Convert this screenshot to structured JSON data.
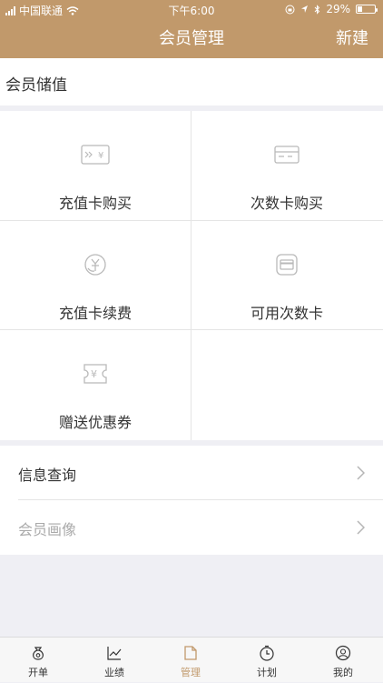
{
  "status_bar": {
    "carrier": "中国联通",
    "time": "下午6:00",
    "battery_percent": "29%",
    "battery_level": 0.29
  },
  "nav": {
    "title": "会员管理",
    "right_action": "新建"
  },
  "section": {
    "title": "会员储值"
  },
  "grid": {
    "items": [
      {
        "label": "充值卡购买",
        "icon": "recharge-card-icon"
      },
      {
        "label": "次数卡购买",
        "icon": "count-card-icon"
      },
      {
        "label": "充值卡续费",
        "icon": "renew-icon"
      },
      {
        "label": "可用次数卡",
        "icon": "available-card-icon"
      },
      {
        "label": "赠送优惠券",
        "icon": "coupon-icon"
      }
    ]
  },
  "list": {
    "items": [
      {
        "label": "信息查询",
        "enabled": true
      },
      {
        "label": "会员画像",
        "enabled": false
      }
    ]
  },
  "tabbar": {
    "items": [
      {
        "label": "开单",
        "icon": "bag-icon"
      },
      {
        "label": "业绩",
        "icon": "chart-icon"
      },
      {
        "label": "管理",
        "icon": "document-icon",
        "active": true
      },
      {
        "label": "计划",
        "icon": "timer-icon"
      },
      {
        "label": "我的",
        "icon": "user-icon"
      }
    ]
  },
  "colors": {
    "accent": "#c1996b",
    "background": "#efeff4"
  }
}
